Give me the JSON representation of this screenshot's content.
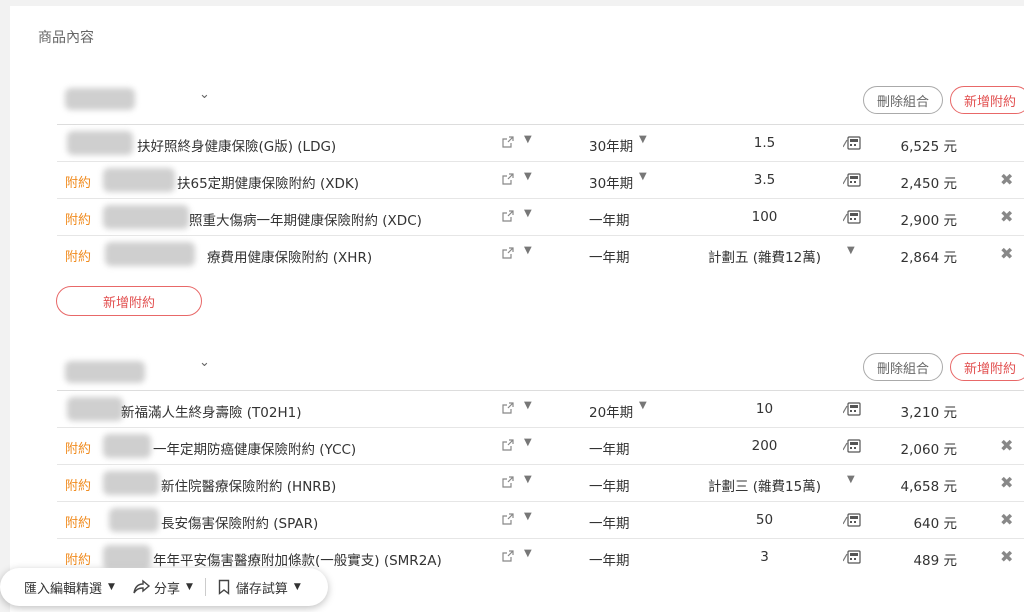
{
  "section": {
    "title": "商品內容"
  },
  "groups": [
    {
      "delete_label": "刪除組合",
      "add_rider_label": "新增附約",
      "rows": [
        {
          "rider": "",
          "name": "扶好照終身健康保險(G版) (LDG)",
          "term": "30年期",
          "term_dropdown": true,
          "amount": "1.5",
          "plan_dropdown": false,
          "premium": "6,525 元",
          "removable": false
        },
        {
          "rider": "附約",
          "name": "扶65定期健康保險附約 (XDK)",
          "term": "30年期",
          "term_dropdown": true,
          "amount": "3.5",
          "plan_dropdown": false,
          "premium": "2,450 元",
          "removable": true
        },
        {
          "rider": "附約",
          "name": "照重大傷病一年期健康保險附約 (XDC)",
          "term": "一年期",
          "term_dropdown": false,
          "amount": "100",
          "plan_dropdown": false,
          "premium": "2,900 元",
          "removable": true
        },
        {
          "rider": "附約",
          "name": "療費用健康保險附約 (XHR)",
          "term": "一年期",
          "term_dropdown": false,
          "amount": "計劃五 (雜費12萬)",
          "plan_dropdown": true,
          "premium": "2,864 元",
          "removable": true
        }
      ]
    },
    {
      "delete_label": "刪除組合",
      "add_rider_label": "新增附約",
      "rows": [
        {
          "rider": "",
          "name": "新福滿人生終身壽險 (T02H1)",
          "term": "20年期",
          "term_dropdown": true,
          "amount": "10",
          "plan_dropdown": false,
          "premium": "3,210 元",
          "removable": false
        },
        {
          "rider": "附約",
          "name": "一年定期防癌健康保險附約 (YCC)",
          "term": "一年期",
          "term_dropdown": false,
          "amount": "200",
          "plan_dropdown": false,
          "premium": "2,060 元",
          "removable": true
        },
        {
          "rider": "附約",
          "name": "新住院醫療保險附約 (HNRB)",
          "term": "一年期",
          "term_dropdown": false,
          "amount": "計劃三 (雜費15萬)",
          "plan_dropdown": true,
          "premium": "4,658 元",
          "removable": true
        },
        {
          "rider": "附約",
          "name": "長安傷害保險附約 (SPAR)",
          "term": "一年期",
          "term_dropdown": false,
          "amount": "50",
          "plan_dropdown": false,
          "premium": "640 元",
          "removable": true
        },
        {
          "rider": "附約",
          "name": "年年平安傷害醫療附加條款(一般實支) (SMR2A)",
          "term": "一年期",
          "term_dropdown": false,
          "amount": "3",
          "plan_dropdown": false,
          "premium": "489 元",
          "removable": true
        }
      ]
    }
  ],
  "add_rider_button": "新增附約",
  "bottom_bar": {
    "import_label": "匯入編輯精選",
    "share_label": "分享",
    "save_label": "儲存試算"
  },
  "icons": {
    "link": "external-link-icon",
    "calc": "calculator-icon",
    "remove": "close-icon",
    "share": "share-icon",
    "bookmark": "bookmark-icon"
  },
  "colors": {
    "accent": "#e25050",
    "rider": "#f08a1c"
  }
}
